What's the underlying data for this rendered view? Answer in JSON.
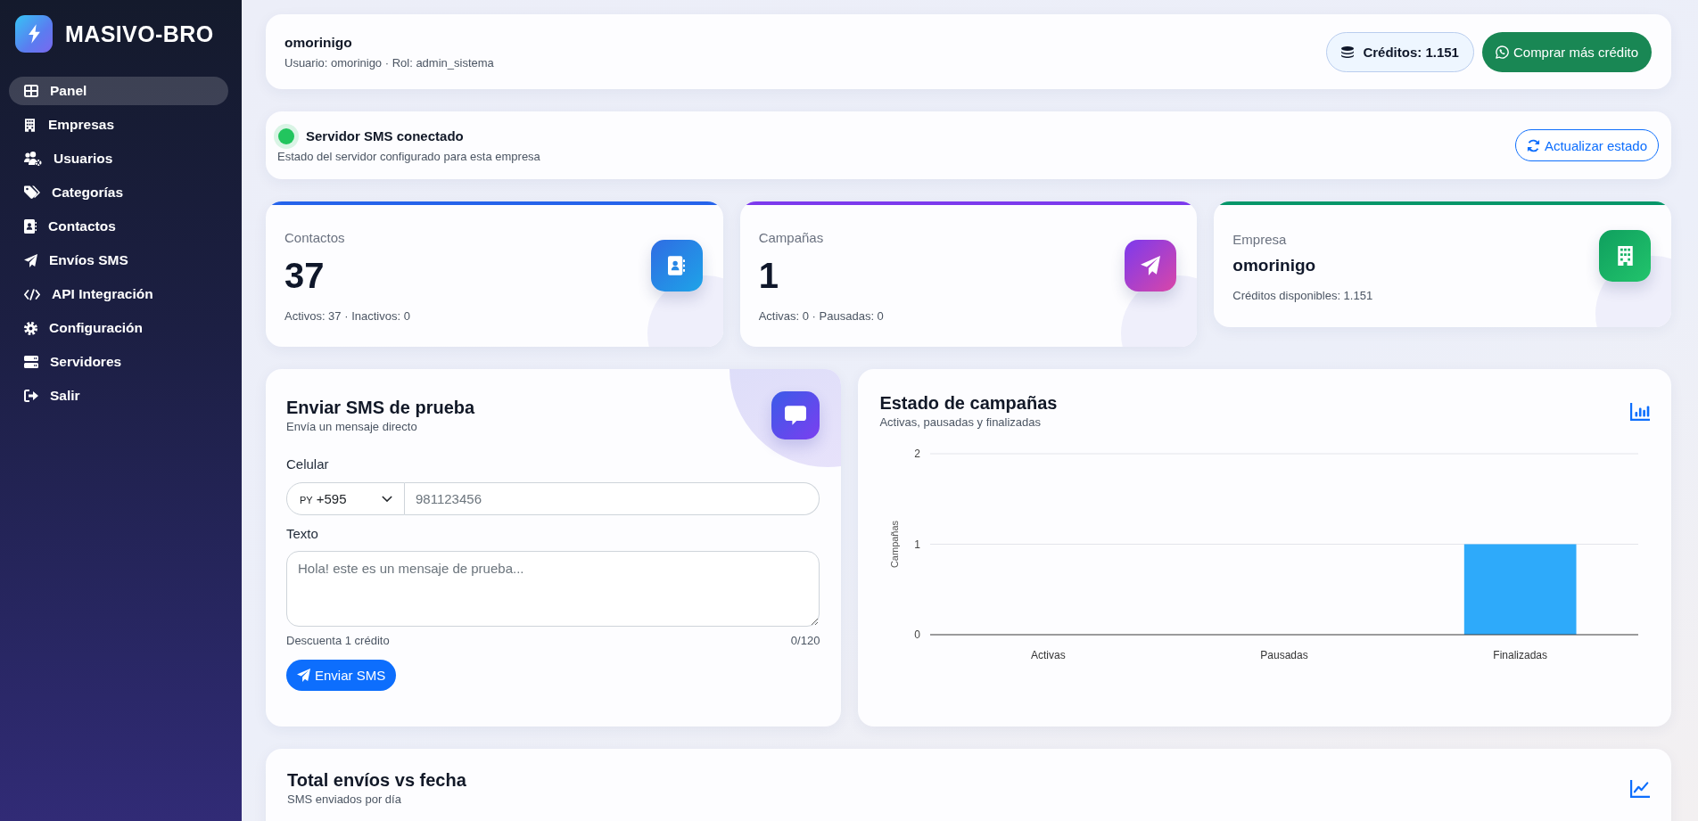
{
  "sidebar": {
    "brand": "MASIVO-BRO",
    "items": [
      {
        "label": "Panel",
        "selected": true
      },
      {
        "label": "Empresas",
        "selected": false
      },
      {
        "label": "Usuarios",
        "selected": false
      },
      {
        "label": "Categorías",
        "selected": false
      },
      {
        "label": "Contactos",
        "selected": false
      },
      {
        "label": "Envíos SMS",
        "selected": false
      },
      {
        "label": "API Integración",
        "selected": false
      },
      {
        "label": "Configuración",
        "selected": false
      },
      {
        "label": "Servidores",
        "selected": false
      },
      {
        "label": "Salir",
        "selected": false
      }
    ]
  },
  "header": {
    "user": "omorinigo",
    "details": "Usuario: omorinigo · Rol: admin_sistema",
    "credits": "Créditos: 1.151",
    "buy_button": "Comprar más crédito"
  },
  "server_status": {
    "connected": true,
    "title": "Servidor SMS conectado",
    "description": "Estado del servidor configurado para esta empresa",
    "refresh_button": "Actualizar estado"
  },
  "stats": [
    {
      "kind": "count",
      "label": "Contactos",
      "value": "37",
      "detail": "Activos: 37 · Inactivos: 0",
      "color": "#2563eb"
    },
    {
      "kind": "count",
      "label": "Campañas",
      "value": "1",
      "detail": "Activas: 0 · Pausadas: 0",
      "color": "#7c3aed"
    },
    {
      "kind": "text",
      "label": "Empresa",
      "value": "omorinigo",
      "detail": "Créditos disponibles: 1.151",
      "color": "#059669"
    }
  ],
  "test_sms": {
    "title": "Enviar SMS de prueba",
    "subtitle": "Envía un mensaje directo",
    "phone_label": "Celular",
    "country_code": "PY",
    "dial_code": "+595",
    "phone_placeholder": "981123456",
    "text_label": "Texto",
    "text_placeholder": "Hola! este es un mensaje de prueba...",
    "cost_note": "Descuenta 1 crédito",
    "char_count": "0/120",
    "send_button": "Enviar SMS"
  },
  "campaign_chart": {
    "title": "Estado de campañas",
    "subtitle": "Activas, pausadas y finalizadas",
    "chart_data": {
      "type": "bar",
      "ylabel": "Campañas",
      "categories": [
        "Activas",
        "Pausadas",
        "Finalizadas"
      ],
      "series": [
        {
          "color": "#2eaafa",
          "values": [
            0,
            0,
            1
          ]
        }
      ],
      "ylim": [
        0,
        2
      ],
      "yticks": [
        0,
        1,
        2
      ]
    }
  },
  "sends_chart": {
    "title": "Total envíos vs fecha",
    "subtitle": "SMS enviados por día"
  }
}
